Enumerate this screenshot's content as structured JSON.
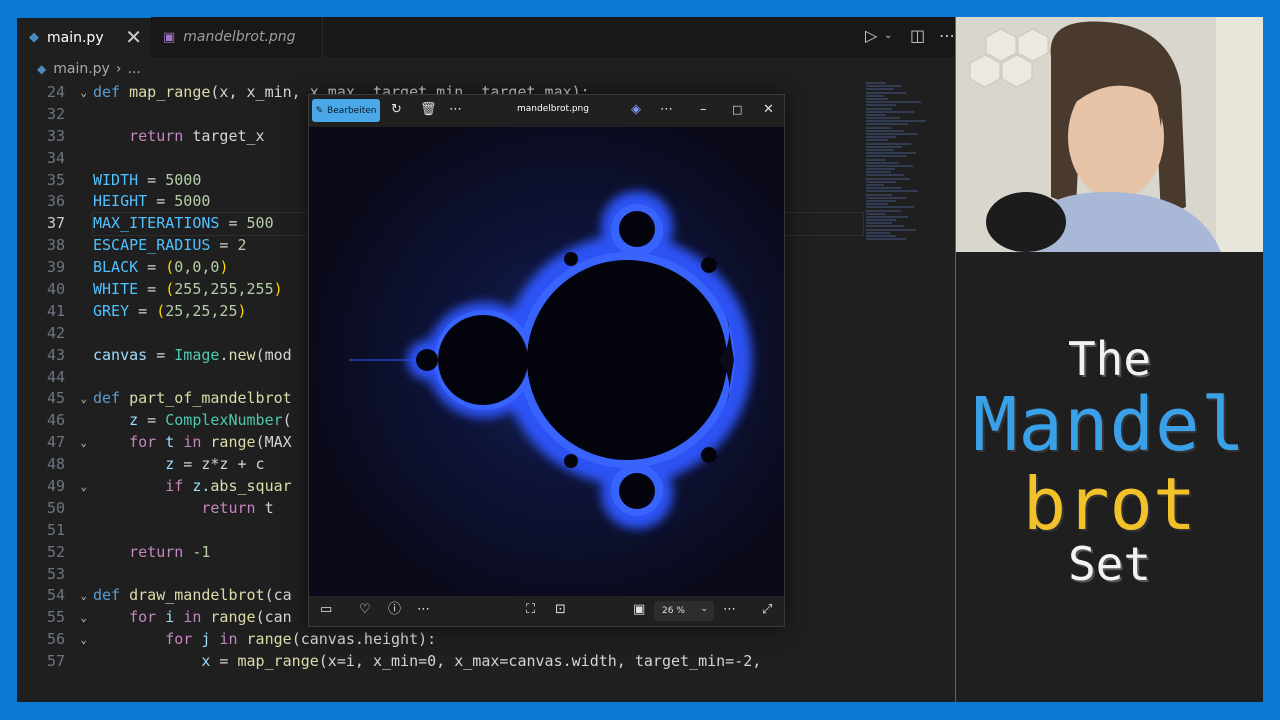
{
  "editor": {
    "tabs": [
      {
        "label": "main.py"
      },
      {
        "label": "mandelbrot.png"
      }
    ],
    "close_glyph": "✕",
    "breadcrumb": {
      "file": "main.py",
      "rest": "..."
    },
    "line_numbers": [
      "24",
      "32",
      "33",
      "34",
      "35",
      "36",
      "37",
      "38",
      "39",
      "40",
      "41",
      "42",
      "43",
      "44",
      "45",
      "46",
      "47",
      "48",
      "49",
      "50",
      "51",
      "52",
      "53",
      "54",
      "55",
      "56",
      "57"
    ],
    "code": {
      "l24": {
        "def": "def",
        "name": "map_range",
        "rest": "(x, x_min, x_max, target_min, target_max):"
      },
      "l33": {
        "kw": "return",
        "rest": " target_x"
      },
      "l35": {
        "name": "WIDTH",
        "op": " = ",
        "val": "5000"
      },
      "l36": {
        "name": "HEIGHT",
        "op": " = ",
        "val": "5000"
      },
      "l37": {
        "name": "MAX_ITERATIONS",
        "op": " = ",
        "val": "500"
      },
      "l38": {
        "name": "ESCAPE_RADIUS",
        "op": " = ",
        "val": "2"
      },
      "l39": {
        "name": "BLACK",
        "op": " = ",
        "p1": "(",
        "val": "0,0,0",
        "p2": ")"
      },
      "l40": {
        "name": "WHITE",
        "op": " = ",
        "p1": "(",
        "val": "255,255,255",
        "p2": ")"
      },
      "l41": {
        "name": "GREY",
        "op": " = ",
        "p1": "(",
        "val": "25,25,25",
        "p2": ")"
      },
      "l43": {
        "var": "canvas",
        "op": " = ",
        "cls": "Image",
        "dot": ".",
        "fn": "new",
        "rest": "(mod"
      },
      "l45": {
        "def": "def",
        "name": "part_of_mandelbrot"
      },
      "l46": {
        "var": "z",
        "op": " = ",
        "cls": "ComplexNumber",
        "rest": "("
      },
      "l47": {
        "kw1": "for",
        "var": " t ",
        "kw2": "in",
        "fn": " range",
        "rest": "(MAX"
      },
      "l48": {
        "var": "z",
        "rest": " = z*z + c"
      },
      "l49": {
        "kw": "if",
        "var": " z.",
        "fn": "abs_squar"
      },
      "l50": {
        "kw": "return",
        "rest": " t"
      },
      "l52": {
        "kw": "return",
        "rest": " -1"
      },
      "l54": {
        "def": "def",
        "name": "draw_mandelbrot",
        "rest": "(ca"
      },
      "l55": {
        "kw1": "for",
        "var": " i ",
        "kw2": "in",
        "fn": " range",
        "rest": "(can"
      },
      "l56": {
        "kw1": "for",
        "var": " j ",
        "kw2": "in",
        "fn": " range",
        "rest": "(canvas.height):"
      },
      "l57": {
        "var": "x",
        "op": " = ",
        "fn": "map_range",
        "rest": "(x=i, x_min=0, x_max=canvas.width, target_min=-2,"
      }
    }
  },
  "viewer": {
    "edit_label": "Bearbeiten",
    "filename": "mandelbrot.png",
    "zoom": "26 %"
  },
  "title_words": [
    "The",
    "Mandel",
    "brot",
    "Set"
  ],
  "colors": {
    "accent": "#0d79d6",
    "blue_title": "#3aa0e8",
    "gold_title": "#f2c22a"
  }
}
